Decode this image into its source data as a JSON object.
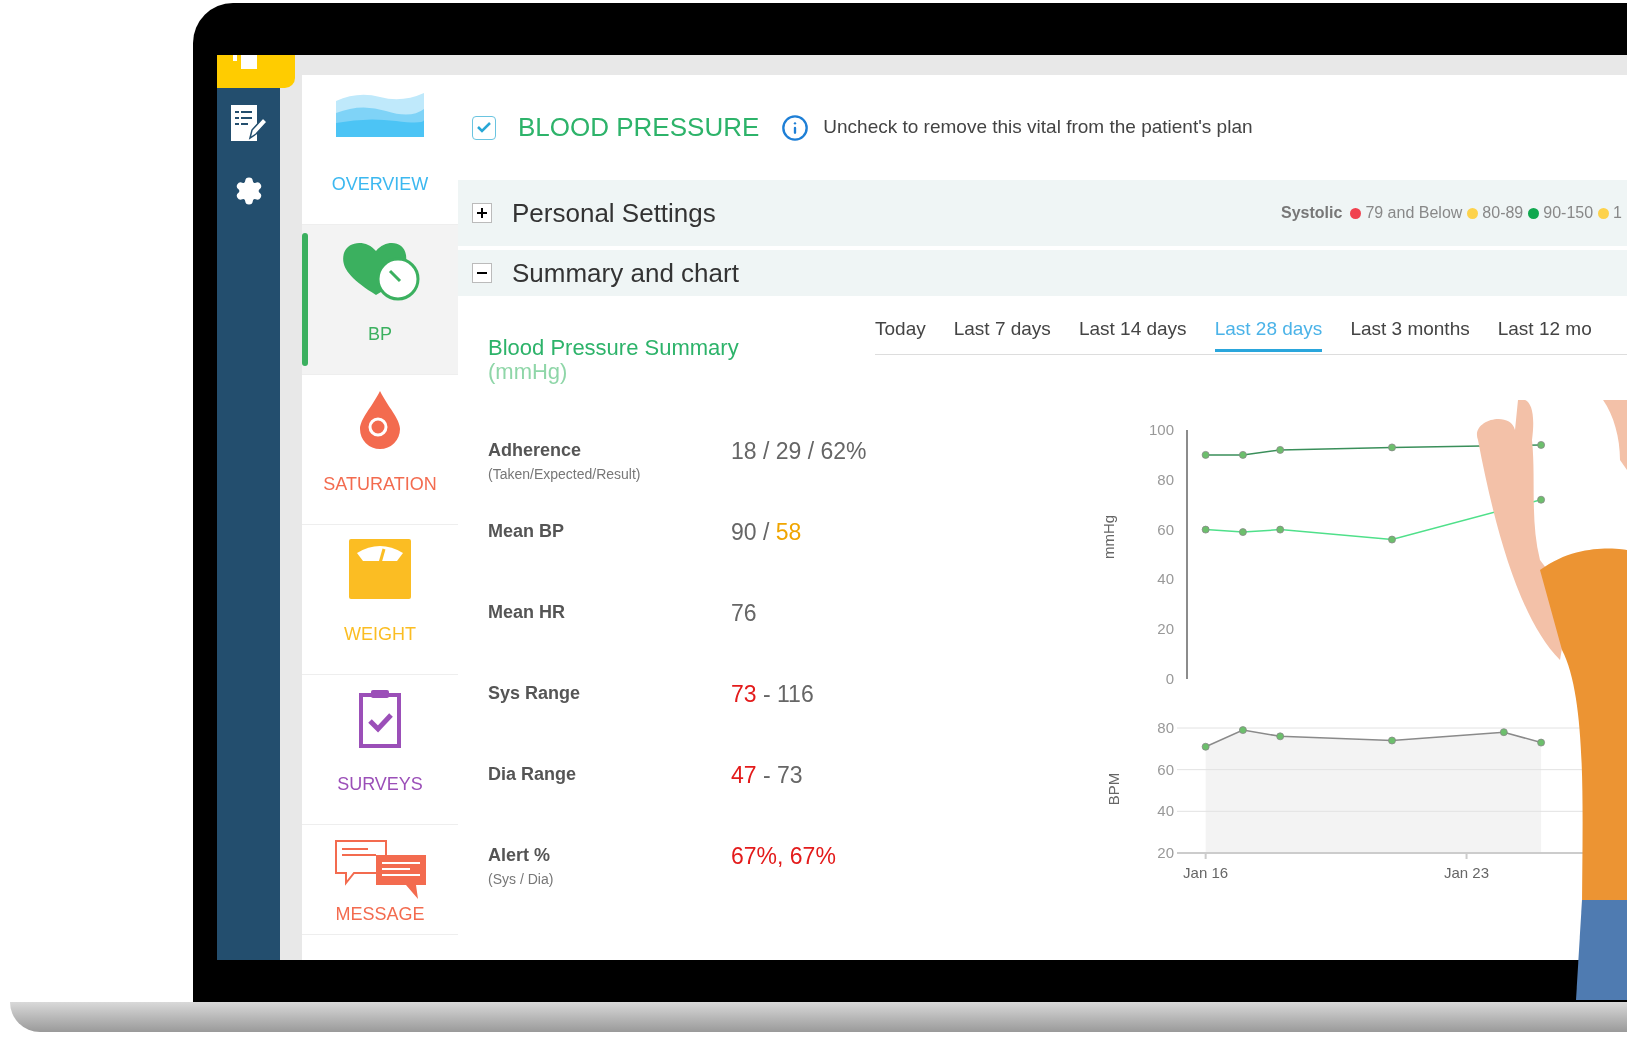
{
  "nav": [
    {
      "label": "OVERVIEW",
      "kind": "overview",
      "selected": false
    },
    {
      "label": "BP",
      "kind": "bp",
      "selected": true
    },
    {
      "label": "SATURATION",
      "kind": "saturation",
      "selected": false
    },
    {
      "label": "WEIGHT",
      "kind": "weight",
      "selected": false
    },
    {
      "label": "SURVEYS",
      "kind": "surveys",
      "selected": false
    },
    {
      "label": "MESSAGE",
      "kind": "message",
      "selected": false
    }
  ],
  "vital": {
    "checked": true,
    "title": "BLOOD PRESSURE",
    "hint": "Uncheck to remove this vital from the patient's plan"
  },
  "sections": [
    {
      "title": "Personal Settings",
      "expanded": false,
      "legend": {
        "label": "Systolic",
        "items": [
          {
            "text": "79 and Below",
            "color": "#f0424f"
          },
          {
            "text": "80-89",
            "color": "#fdd24b"
          },
          {
            "text": "90-150",
            "color": "#10a84f"
          },
          {
            "text": "1",
            "color": "#fdd24b"
          }
        ]
      }
    },
    {
      "title": "Summary and chart",
      "expanded": true
    }
  ],
  "summary": {
    "title": "Blood Pressure Summary",
    "unit": "(mmHg)",
    "rows": [
      {
        "label": "Adherence",
        "note": "(Taken/Expected/Result)",
        "value": [
          {
            "text": "18 / 29 / 62%",
            "color": "#666666"
          }
        ]
      },
      {
        "label": "Mean BP",
        "value": [
          {
            "text": "90 / ",
            "color": "#666666"
          },
          {
            "text": "58",
            "color": "#f0a500"
          }
        ]
      },
      {
        "label": "Mean HR",
        "value": [
          {
            "text": "76",
            "color": "#666666"
          }
        ]
      },
      {
        "label": "Sys Range",
        "value": [
          {
            "text": "73",
            "color": "#e31b1b"
          },
          {
            "text": " - 116",
            "color": "#666666"
          }
        ]
      },
      {
        "label": "Dia Range",
        "value": [
          {
            "text": "47",
            "color": "#e31b1b"
          },
          {
            "text": " - 73",
            "color": "#666666"
          }
        ]
      },
      {
        "label": "Alert %",
        "note": "(Sys / Dia)",
        "value": [
          {
            "text": "67%, 67%",
            "color": "#e31b1b"
          }
        ]
      }
    ]
  },
  "tabs": [
    {
      "label": "Today",
      "selected": false
    },
    {
      "label": "Last 7 days",
      "selected": false
    },
    {
      "label": "Last 14 days",
      "selected": false
    },
    {
      "label": "Last 28 days",
      "selected": true
    },
    {
      "label": "Last 3 months",
      "selected": false
    },
    {
      "label": "Last 12 mo",
      "selected": false
    }
  ],
  "bp_chart": {
    "chart_data": {
      "type": "line",
      "ylabel": "mmHg",
      "ylim": [
        0,
        100
      ],
      "yticks": [
        0,
        20,
        40,
        60,
        80,
        100
      ],
      "series": [
        {
          "color": "#3a8f5a",
          "marker": "circle",
          "values": [
            90,
            90,
            92,
            null,
            null,
            93,
            null,
            null,
            null,
            94
          ]
        },
        {
          "color": "#4fe08a",
          "marker": "circle",
          "values": [
            60,
            59,
            60,
            null,
            null,
            56,
            null,
            null,
            null,
            72
          ]
        }
      ]
    }
  },
  "hr_chart": {
    "chart_data": {
      "type": "area",
      "ylabel": "BPM",
      "categories": [
        "Jan 16",
        null,
        null,
        null,
        null,
        null,
        null,
        "Jan 23",
        null,
        null,
        null
      ],
      "ylim": [
        20,
        80
      ],
      "yticks": [
        20,
        40,
        60,
        80
      ],
      "series": [
        {
          "color": "#8a8a8a",
          "marker": "circle",
          "values": [
            71,
            79,
            76,
            null,
            null,
            74,
            null,
            null,
            78,
            73,
            null
          ]
        }
      ]
    }
  }
}
